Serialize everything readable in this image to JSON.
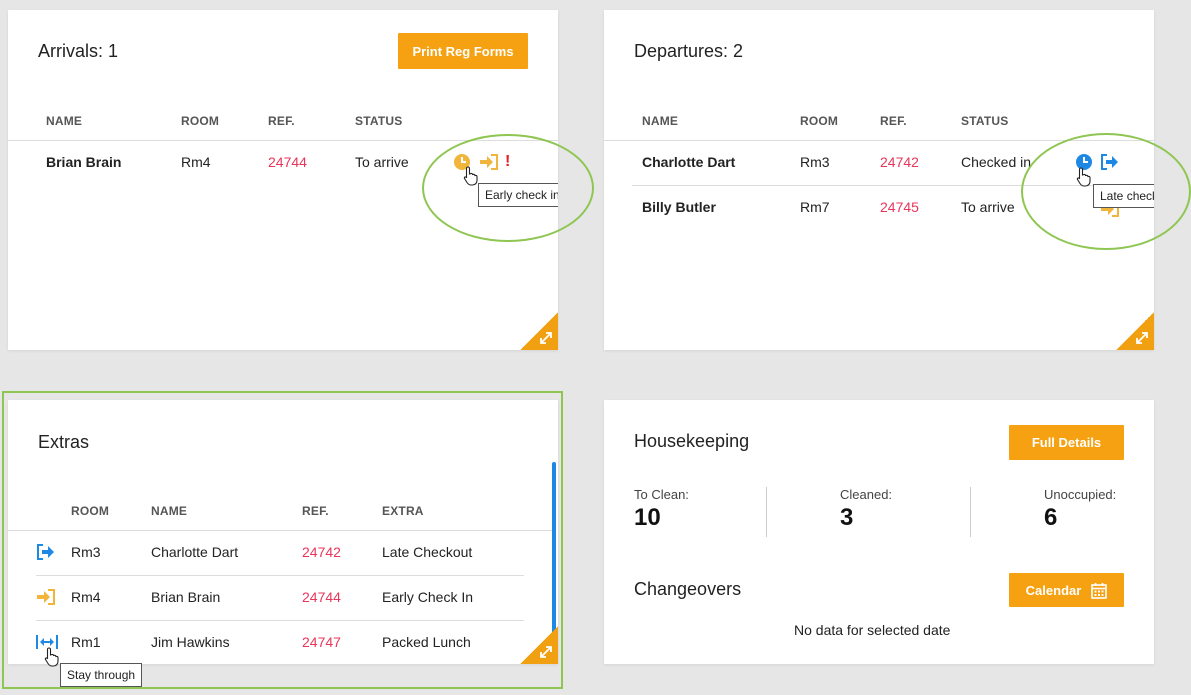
{
  "arrivals": {
    "title": "Arrivals: 1",
    "print_button": "Print Reg Forms",
    "headers": [
      "NAME",
      "ROOM",
      "REF.",
      "STATUS"
    ],
    "rows": [
      {
        "name": "Brian Brain",
        "room": "Rm4",
        "ref": "24744",
        "status": "To arrive",
        "alert": "!"
      }
    ],
    "tooltip": "Early check in"
  },
  "departures": {
    "title": "Departures: 2",
    "headers": [
      "NAME",
      "ROOM",
      "REF.",
      "STATUS"
    ],
    "rows": [
      {
        "name": "Charlotte Dart",
        "room": "Rm3",
        "ref": "24742",
        "status": "Checked in"
      },
      {
        "name": "Billy Butler",
        "room": "Rm7",
        "ref": "24745",
        "status": "To arrive"
      }
    ],
    "tooltip": "Late check out"
  },
  "extras": {
    "title": "Extras",
    "headers": [
      "ROOM",
      "NAME",
      "REF.",
      "EXTRA"
    ],
    "rows": [
      {
        "room": "Rm3",
        "name": "Charlotte Dart",
        "ref": "24742",
        "extra": "Late Checkout",
        "icon": "check-out-icon"
      },
      {
        "room": "Rm4",
        "name": "Brian Brain",
        "ref": "24744",
        "extra": "Early Check In",
        "icon": "check-in-icon"
      },
      {
        "room": "Rm1",
        "name": "Jim Hawkins",
        "ref": "24747",
        "extra": "Packed Lunch",
        "icon": "stay-through-icon"
      }
    ],
    "tooltip": "Stay through"
  },
  "housekeeping": {
    "title": "Housekeeping",
    "full_details_button": "Full Details",
    "stats": [
      {
        "label": "To Clean:",
        "value": "10"
      },
      {
        "label": "Cleaned:",
        "value": "3"
      },
      {
        "label": "Unoccupied:",
        "value": "6"
      }
    ],
    "changeovers_title": "Changeovers",
    "calendar_button": "Calendar",
    "empty_message": "No data for selected date"
  },
  "colors": {
    "accent": "#f5a112",
    "ref": "#e8355a",
    "blue": "#1e88e5",
    "highlight": "#8fc652"
  }
}
